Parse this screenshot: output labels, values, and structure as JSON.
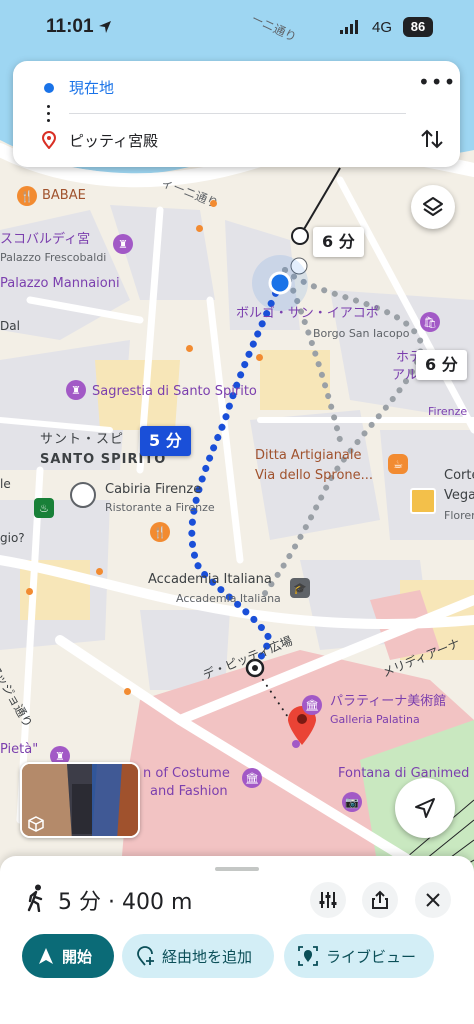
{
  "status_bar": {
    "time": "11:01",
    "network": "4G",
    "battery": "86"
  },
  "directions": {
    "origin": "現在地",
    "destination": "ピッティ宮殿",
    "more_icon": "more-horiz-icon",
    "swap_icon": "swap-vertical-icon"
  },
  "map": {
    "labels": {
      "street_arno": "ィーニ通り",
      "street_top": "ーニ通り",
      "babae": "BABAE",
      "frescobaldi_jp": "スコバルディ宮",
      "frescobaldi_it": "Palazzo Frescobaldi",
      "mannaioni": "Palazzo Mannaioni",
      "borgo_jp": "ボルゴ・サン・イアコポ",
      "borgo_it": "Borgo San Iacopo",
      "hotel_jp": "ホテ",
      "arno_jp": "アルノ",
      "sagrestia": "Sagrestia di Santo Spirito",
      "santo_spirito_jp": "サント・スピ",
      "santo_spirito_it": "SANTO SPIRITO",
      "ditta1": "Ditta Artigianale",
      "ditta2": "Via dello Sprone...",
      "cabiria": "Cabiria Firenze",
      "cabiria_sub": "Ristorante a Firenze",
      "firenze": "Firenze",
      "corte": "Corte",
      "vega": "Vega",
      "fiore": "Floren",
      "accademia": "Accademia Italiana",
      "accademia_sub": "Accademia Italiana",
      "pitti_square": "デ・ピッティ広場",
      "maggio": "マッジョ通り",
      "meridiana": "メリディアーナ",
      "palatina_jp": "パラティーナ美術館",
      "palatina_it": "Galleria Palatina",
      "costume": "n of Costume",
      "fashion": "and Fashion",
      "fontana": "Fontana di Ganimed",
      "pieta": "Pietà\"",
      "la_left": "le",
      "gio": "gio?",
      "dal": "Dal"
    },
    "callouts": {
      "alt1": "6 分",
      "alt2": "6 分",
      "selected": "5 分"
    }
  },
  "buttons": {
    "layers_icon": "layers-icon",
    "locate_icon": "navigation-arrow-icon"
  },
  "sheet": {
    "mode_icon": "walking-icon",
    "summary": "5 分 · 400 m",
    "options_icon": "tune-icon",
    "share_icon": "share-icon",
    "close_icon": "close-icon",
    "start_label": "開始",
    "add_stop_label": "経由地を追加",
    "live_view_label": "ライブビュー"
  },
  "colors": {
    "route_blue": "#1a4fd8",
    "alt_route_gray": "#9aa0a6",
    "river": "#9ed6f2",
    "accent_teal": "#0b6b77"
  }
}
